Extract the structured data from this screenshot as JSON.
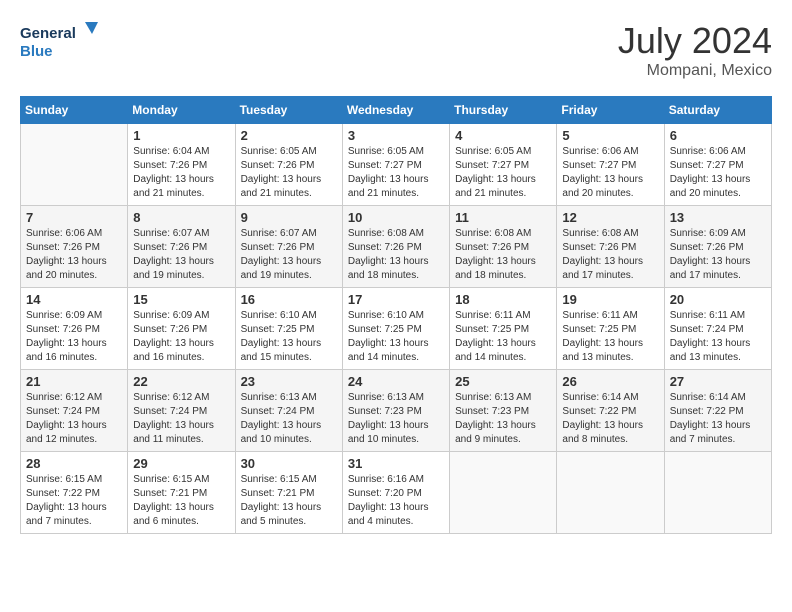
{
  "header": {
    "logo_line1": "General",
    "logo_line2": "Blue",
    "month_year": "July 2024",
    "location": "Mompani, Mexico"
  },
  "days_of_week": [
    "Sunday",
    "Monday",
    "Tuesday",
    "Wednesday",
    "Thursday",
    "Friday",
    "Saturday"
  ],
  "weeks": [
    [
      {
        "day": "",
        "sunrise": "",
        "sunset": "",
        "daylight": ""
      },
      {
        "day": "1",
        "sunrise": "Sunrise: 6:04 AM",
        "sunset": "Sunset: 7:26 PM",
        "daylight": "Daylight: 13 hours and 21 minutes."
      },
      {
        "day": "2",
        "sunrise": "Sunrise: 6:05 AM",
        "sunset": "Sunset: 7:26 PM",
        "daylight": "Daylight: 13 hours and 21 minutes."
      },
      {
        "day": "3",
        "sunrise": "Sunrise: 6:05 AM",
        "sunset": "Sunset: 7:27 PM",
        "daylight": "Daylight: 13 hours and 21 minutes."
      },
      {
        "day": "4",
        "sunrise": "Sunrise: 6:05 AM",
        "sunset": "Sunset: 7:27 PM",
        "daylight": "Daylight: 13 hours and 21 minutes."
      },
      {
        "day": "5",
        "sunrise": "Sunrise: 6:06 AM",
        "sunset": "Sunset: 7:27 PM",
        "daylight": "Daylight: 13 hours and 20 minutes."
      },
      {
        "day": "6",
        "sunrise": "Sunrise: 6:06 AM",
        "sunset": "Sunset: 7:27 PM",
        "daylight": "Daylight: 13 hours and 20 minutes."
      }
    ],
    [
      {
        "day": "7",
        "sunrise": "Sunrise: 6:06 AM",
        "sunset": "Sunset: 7:26 PM",
        "daylight": "Daylight: 13 hours and 20 minutes."
      },
      {
        "day": "8",
        "sunrise": "Sunrise: 6:07 AM",
        "sunset": "Sunset: 7:26 PM",
        "daylight": "Daylight: 13 hours and 19 minutes."
      },
      {
        "day": "9",
        "sunrise": "Sunrise: 6:07 AM",
        "sunset": "Sunset: 7:26 PM",
        "daylight": "Daylight: 13 hours and 19 minutes."
      },
      {
        "day": "10",
        "sunrise": "Sunrise: 6:08 AM",
        "sunset": "Sunset: 7:26 PM",
        "daylight": "Daylight: 13 hours and 18 minutes."
      },
      {
        "day": "11",
        "sunrise": "Sunrise: 6:08 AM",
        "sunset": "Sunset: 7:26 PM",
        "daylight": "Daylight: 13 hours and 18 minutes."
      },
      {
        "day": "12",
        "sunrise": "Sunrise: 6:08 AM",
        "sunset": "Sunset: 7:26 PM",
        "daylight": "Daylight: 13 hours and 17 minutes."
      },
      {
        "day": "13",
        "sunrise": "Sunrise: 6:09 AM",
        "sunset": "Sunset: 7:26 PM",
        "daylight": "Daylight: 13 hours and 17 minutes."
      }
    ],
    [
      {
        "day": "14",
        "sunrise": "Sunrise: 6:09 AM",
        "sunset": "Sunset: 7:26 PM",
        "daylight": "Daylight: 13 hours and 16 minutes."
      },
      {
        "day": "15",
        "sunrise": "Sunrise: 6:09 AM",
        "sunset": "Sunset: 7:26 PM",
        "daylight": "Daylight: 13 hours and 16 minutes."
      },
      {
        "day": "16",
        "sunrise": "Sunrise: 6:10 AM",
        "sunset": "Sunset: 7:25 PM",
        "daylight": "Daylight: 13 hours and 15 minutes."
      },
      {
        "day": "17",
        "sunrise": "Sunrise: 6:10 AM",
        "sunset": "Sunset: 7:25 PM",
        "daylight": "Daylight: 13 hours and 14 minutes."
      },
      {
        "day": "18",
        "sunrise": "Sunrise: 6:11 AM",
        "sunset": "Sunset: 7:25 PM",
        "daylight": "Daylight: 13 hours and 14 minutes."
      },
      {
        "day": "19",
        "sunrise": "Sunrise: 6:11 AM",
        "sunset": "Sunset: 7:25 PM",
        "daylight": "Daylight: 13 hours and 13 minutes."
      },
      {
        "day": "20",
        "sunrise": "Sunrise: 6:11 AM",
        "sunset": "Sunset: 7:24 PM",
        "daylight": "Daylight: 13 hours and 13 minutes."
      }
    ],
    [
      {
        "day": "21",
        "sunrise": "Sunrise: 6:12 AM",
        "sunset": "Sunset: 7:24 PM",
        "daylight": "Daylight: 13 hours and 12 minutes."
      },
      {
        "day": "22",
        "sunrise": "Sunrise: 6:12 AM",
        "sunset": "Sunset: 7:24 PM",
        "daylight": "Daylight: 13 hours and 11 minutes."
      },
      {
        "day": "23",
        "sunrise": "Sunrise: 6:13 AM",
        "sunset": "Sunset: 7:24 PM",
        "daylight": "Daylight: 13 hours and 10 minutes."
      },
      {
        "day": "24",
        "sunrise": "Sunrise: 6:13 AM",
        "sunset": "Sunset: 7:23 PM",
        "daylight": "Daylight: 13 hours and 10 minutes."
      },
      {
        "day": "25",
        "sunrise": "Sunrise: 6:13 AM",
        "sunset": "Sunset: 7:23 PM",
        "daylight": "Daylight: 13 hours and 9 minutes."
      },
      {
        "day": "26",
        "sunrise": "Sunrise: 6:14 AM",
        "sunset": "Sunset: 7:22 PM",
        "daylight": "Daylight: 13 hours and 8 minutes."
      },
      {
        "day": "27",
        "sunrise": "Sunrise: 6:14 AM",
        "sunset": "Sunset: 7:22 PM",
        "daylight": "Daylight: 13 hours and 7 minutes."
      }
    ],
    [
      {
        "day": "28",
        "sunrise": "Sunrise: 6:15 AM",
        "sunset": "Sunset: 7:22 PM",
        "daylight": "Daylight: 13 hours and 7 minutes."
      },
      {
        "day": "29",
        "sunrise": "Sunrise: 6:15 AM",
        "sunset": "Sunset: 7:21 PM",
        "daylight": "Daylight: 13 hours and 6 minutes."
      },
      {
        "day": "30",
        "sunrise": "Sunrise: 6:15 AM",
        "sunset": "Sunset: 7:21 PM",
        "daylight": "Daylight: 13 hours and 5 minutes."
      },
      {
        "day": "31",
        "sunrise": "Sunrise: 6:16 AM",
        "sunset": "Sunset: 7:20 PM",
        "daylight": "Daylight: 13 hours and 4 minutes."
      },
      {
        "day": "",
        "sunrise": "",
        "sunset": "",
        "daylight": ""
      },
      {
        "day": "",
        "sunrise": "",
        "sunset": "",
        "daylight": ""
      },
      {
        "day": "",
        "sunrise": "",
        "sunset": "",
        "daylight": ""
      }
    ]
  ]
}
